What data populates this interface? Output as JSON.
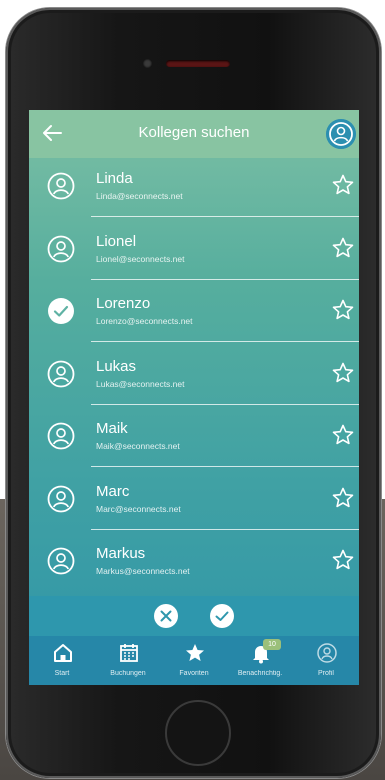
{
  "header": {
    "title": "Kollegen suchen"
  },
  "colleagues": [
    {
      "name": "Linda",
      "email": "Linda@seconnects.net",
      "selected": false
    },
    {
      "name": "Lionel",
      "email": "Lionel@seconnects.net",
      "selected": false
    },
    {
      "name": "Lorenzo",
      "email": "Lorenzo@seconnects.net",
      "selected": true
    },
    {
      "name": "Lukas",
      "email": "Lukas@seconnects.net",
      "selected": false
    },
    {
      "name": "Maik",
      "email": "Maik@seconnects.net",
      "selected": false
    },
    {
      "name": "Marc",
      "email": "Marc@seconnects.net",
      "selected": false
    },
    {
      "name": "Markus",
      "email": "Markus@seconnects.net",
      "selected": false
    }
  ],
  "tabs": [
    {
      "label": "Start",
      "icon": "home-icon"
    },
    {
      "label": "Buchungen",
      "icon": "calendar-icon"
    },
    {
      "label": "Favoriten",
      "icon": "star-icon"
    },
    {
      "label": "Benachrichtig.",
      "icon": "bell-icon",
      "badge": "10"
    },
    {
      "label": "Profil",
      "icon": "profile-icon"
    }
  ],
  "colors": {
    "appbar": "#88c4a2",
    "tabbar": "#2687a8",
    "accent": "#2c8fb0"
  }
}
